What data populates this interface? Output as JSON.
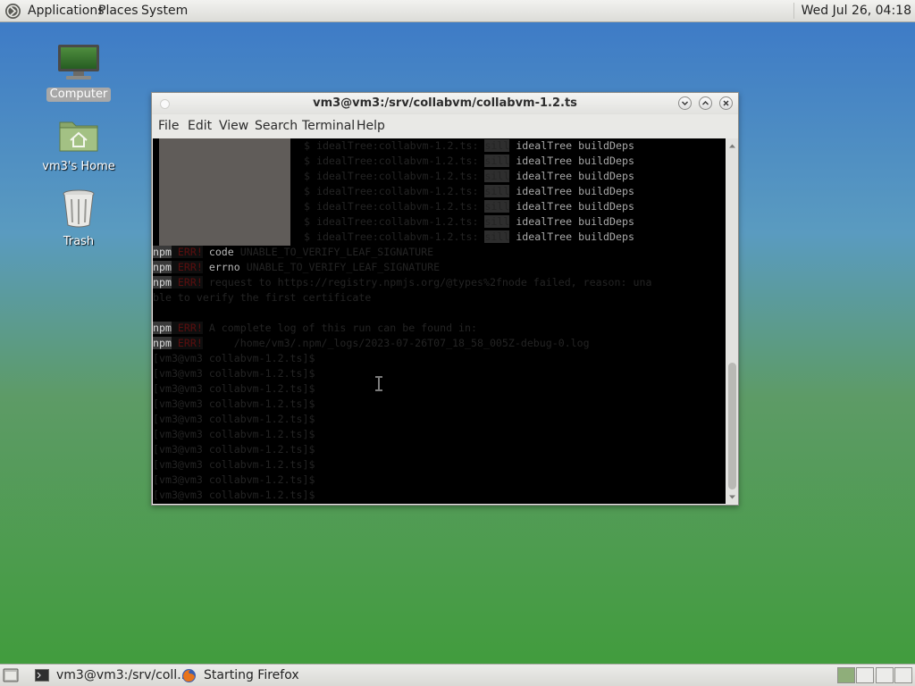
{
  "top_panel": {
    "menus": [
      "Applications",
      "Places",
      "System"
    ],
    "clock": "Wed Jul 26, 04:18"
  },
  "desktop": {
    "icons": [
      {
        "label": "Computer",
        "icon": "computer-icon",
        "selected": true
      },
      {
        "label": "vm3's Home",
        "icon": "home-folder-icon",
        "selected": false
      },
      {
        "label": "Trash",
        "icon": "trash-icon",
        "selected": false
      }
    ]
  },
  "window": {
    "title": "vm3@vm3:/srv/collabvm/collabvm-1.2.ts",
    "menus": [
      "File",
      "Edit",
      "View",
      "Search",
      "Terminal",
      "Help"
    ],
    "terminal_lines": {
      "ideal_rows": [
        {
          "prefix": "$ idealTree:collabvm-1.2.ts: ",
          "tag": "sill",
          "rest": " idealTree buildDeps"
        },
        {
          "prefix": "$ idealTree:collabvm-1.2.ts: ",
          "tag": "sill",
          "rest": " idealTree buildDeps"
        },
        {
          "prefix": "$ idealTree:collabvm-1.2.ts: ",
          "tag": "sill",
          "rest": " idealTree buildDeps"
        },
        {
          "prefix": "$ idealTree:collabvm-1.2.ts: ",
          "tag": "sill",
          "rest": " idealTree buildDeps"
        },
        {
          "prefix": "$ idealTree:collabvm-1.2.ts: ",
          "tag": "sill",
          "rest": " idealTree buildDeps"
        },
        {
          "prefix": "$ idealTree:collabvm-1.2.ts: ",
          "tag": "sill",
          "rest": " idealTree buildDeps"
        },
        {
          "prefix": "$ idealTree:collabvm-1.2.ts: ",
          "tag": "sill",
          "rest": " idealTree buildDeps"
        }
      ],
      "npm_rows": [
        {
          "npm": "npm",
          "err": " ERR!",
          "label": " code",
          "text": " UNABLE_TO_VERIFY_LEAF_SIGNATURE"
        },
        {
          "npm": "npm",
          "err": " ERR!",
          "label": " errno",
          "text": " UNABLE_TO_VERIFY_LEAF_SIGNATURE"
        },
        {
          "npm": "npm",
          "err": " ERR!",
          "label": "",
          "text": " request to https://registry.npmjs.org/@types%2fnode failed, reason: una"
        }
      ],
      "wrap_line": "ble to verify the first certificate",
      "log_rows": [
        {
          "npm": "npm",
          "err": " ERR!",
          "text": " A complete log of this run can be found in:"
        },
        {
          "npm": "npm",
          "err": " ERR!",
          "text": "     /home/vm3/.npm/_logs/2023-07-26T07_18_58_005Z-debug-0.log"
        }
      ],
      "prompts": [
        "[vm3@vm3 collabvm-1.2.ts]$",
        "[vm3@vm3 collabvm-1.2.ts]$",
        "[vm3@vm3 collabvm-1.2.ts]$",
        "[vm3@vm3 collabvm-1.2.ts]$",
        "[vm3@vm3 collabvm-1.2.ts]$",
        "[vm3@vm3 collabvm-1.2.ts]$",
        "[vm3@vm3 collabvm-1.2.ts]$",
        "[vm3@vm3 collabvm-1.2.ts]$",
        "[vm3@vm3 collabvm-1.2.ts]$",
        "[vm3@vm3 collabvm-1.2.ts]$"
      ]
    }
  },
  "taskbar": {
    "tasks": [
      {
        "label": "vm3@vm3:/srv/coll...",
        "icon": "terminal-icon"
      },
      {
        "label": "Starting Firefox",
        "icon": "firefox-icon"
      }
    ]
  },
  "colors": {
    "terminal_bg": "#000000",
    "npm_err": "#5b0f0f",
    "panel": "#e4e4e0"
  }
}
